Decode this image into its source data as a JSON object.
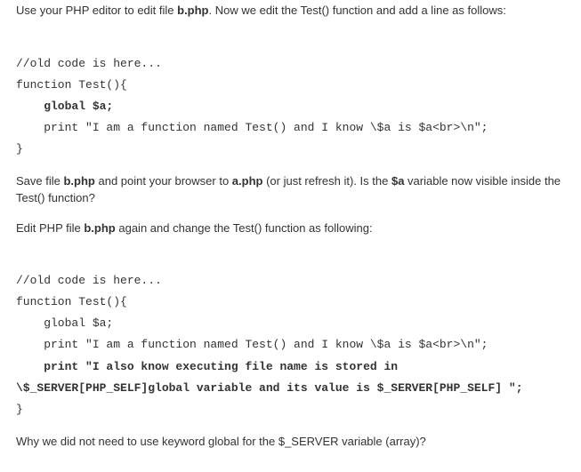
{
  "intro": {
    "t1": "Use your PHP editor to edit file ",
    "t2": "b.php",
    "t3": ". Now we edit the Test() function and add a line as follows:"
  },
  "code1": {
    "l1": "//old code is here...",
    "l2": "function Test(){",
    "l3": "    global $a;",
    "l4": "    print \"I am a function named Test() and I know \\$a is $a<br>\\n\";",
    "l5": "}"
  },
  "mid1": {
    "t1": "Save file ",
    "t2": "b.php",
    "t3": " and point your browser to ",
    "t4": "a.php",
    "t5": " (or just refresh it). Is the ",
    "t6": "$a",
    "t7": " variable now visible inside the Test() function?"
  },
  "mid2": {
    "t1": "Edit PHP file ",
    "t2": "b.php",
    "t3": " again and change the Test() function as following:"
  },
  "code2": {
    "l1": "//old code is here...",
    "l2": "function Test(){",
    "l3": "    global $a;",
    "l4": "    print \"I am a function named Test() and I know \\$a is $a<br>\\n\";",
    "l5a": "    print \"I also know executing file name is stored in",
    "l5b": "\\$_SERVER[PHP_SELF]global variable and its value is $_SERVER[PHP_SELF] \";",
    "l6": "}"
  },
  "q": {
    "t1": "Why we did not need to use keyword global for the $_SERVER variable (array)?"
  }
}
